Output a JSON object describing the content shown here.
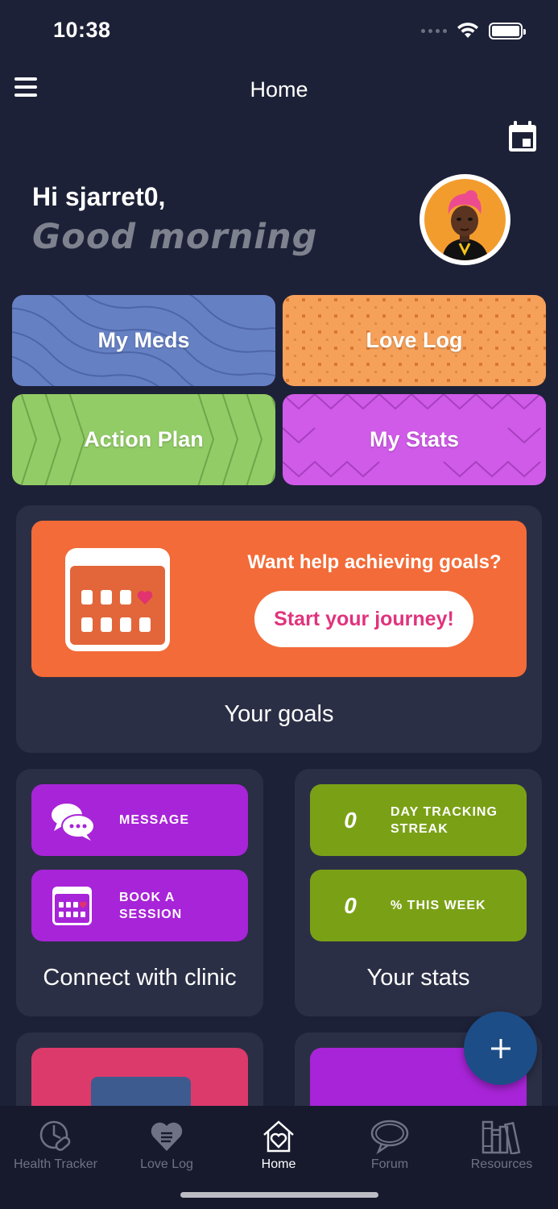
{
  "status_bar": {
    "time": "10:38"
  },
  "header": {
    "title": "Home"
  },
  "greeting": {
    "hello": "Hi sjarret0,",
    "salutation": "Good morning"
  },
  "tiles": {
    "my_meds": "My Meds",
    "love_log": "Love Log",
    "action_plan": "Action Plan",
    "my_stats": "My Stats"
  },
  "goals": {
    "question": "Want help achieving goals?",
    "button": "Start your journey!",
    "title": "Your goals"
  },
  "clinic": {
    "message": "MESSAGE",
    "book_line1": "BOOK A",
    "book_line2": "SESSION",
    "title": "Connect with clinic"
  },
  "stats": {
    "streak_value": "0",
    "streak_line1": "DAY TRACKING",
    "streak_line2": "STREAK",
    "week_value": "0",
    "week_label": "% THIS WEEK",
    "title": "Your stats"
  },
  "tabbar": {
    "items": [
      {
        "label": "Health Tracker",
        "icon": "health-tracker-icon"
      },
      {
        "label": "Love Log",
        "icon": "heart-icon"
      },
      {
        "label": "Home",
        "icon": "home-icon",
        "active": true
      },
      {
        "label": "Forum",
        "icon": "chat-bubble-icon"
      },
      {
        "label": "Resources",
        "icon": "books-icon"
      }
    ]
  },
  "colors": {
    "background": "#1d2137",
    "card": "#2b2f45",
    "meds": "#6680c4",
    "love_log": "#f6a15a",
    "action_plan": "#92cc66",
    "my_stats": "#d05be8",
    "goals_banner": "#f26b38",
    "purple_pill": "#a824d8",
    "green_pill": "#7aa116",
    "fab": "#1c4d87"
  }
}
